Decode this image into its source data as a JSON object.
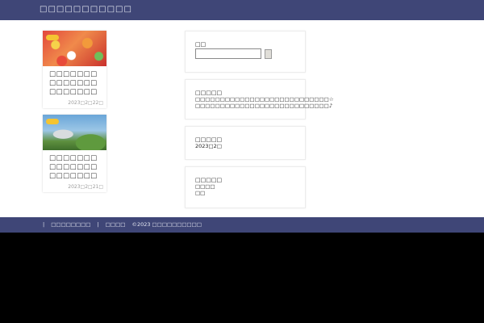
{
  "header": {
    "site_title": "□□□□□□□□□□□"
  },
  "posts": [
    {
      "title": "□□□□□□□□□□□□□□□□□□□□□□□□□□□☆",
      "date": "2023□2□22□",
      "tag_color": "#f4c431"
    },
    {
      "title": "□□□□□□□□□□□□□□□□□□□□□□□□□□□♪",
      "date": "2023□2□21□",
      "tag_color": "#f4c431"
    }
  ],
  "sidebar": {
    "search": {
      "heading": "□□",
      "placeholder": ""
    },
    "recent": {
      "heading": "□□□□□",
      "line1": "□□□□□□□□□□□□□□□□□□□□□□□□□□□☆",
      "line2": "□□□□□□□□□□□□□□□□□□□□□□□□□□□♪"
    },
    "archive": {
      "heading": "□□□□□",
      "item1": "2023□2□"
    },
    "category": {
      "heading": "□□□□□",
      "item1": "□□□□",
      "item2": "□□"
    }
  },
  "footer": {
    "link1": "□□□□□□□□",
    "link2": "□□□□",
    "copyright": "©2023  □□□□□□□□□□"
  },
  "colors": {
    "header_bg": "#3f4677",
    "footer_bg": "#3f4677",
    "page_bg": "#ffffff"
  }
}
